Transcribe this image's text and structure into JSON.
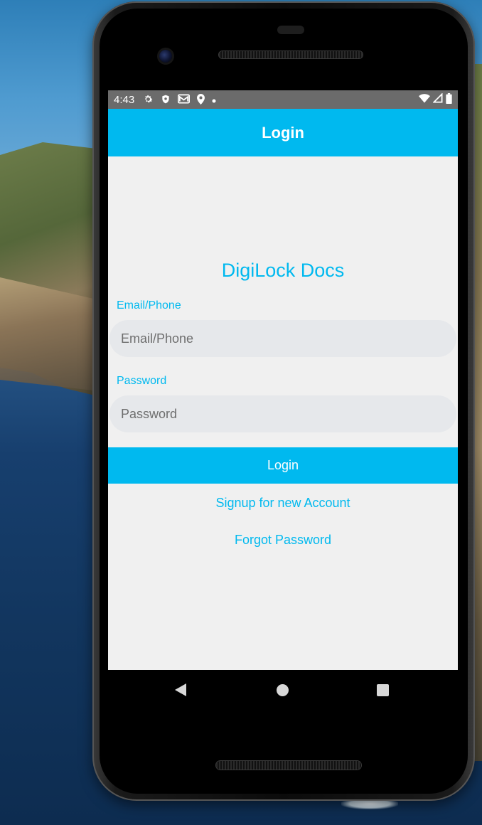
{
  "colors": {
    "accent": "#00b9ef",
    "status_bar": "#6b6b6b",
    "screen_bg": "#f0f0f0",
    "input_bg": "#e6e8eb"
  },
  "status_bar": {
    "time": "4:43",
    "icons_left": [
      "gear-icon",
      "shield-icon",
      "mail-icon",
      "location-icon",
      "dot-icon"
    ],
    "icons_right": [
      "wifi-icon",
      "signal-icon",
      "battery-icon"
    ]
  },
  "app_bar": {
    "title": "Login"
  },
  "brand": {
    "title": "DigiLock Docs"
  },
  "form": {
    "email_label": "Email/Phone",
    "email_placeholder": "Email/Phone",
    "email_value": "",
    "password_label": "Password",
    "password_placeholder": "Password",
    "password_value": "",
    "login_button": "Login"
  },
  "links": {
    "signup": "Signup for new Account",
    "forgot": "Forgot Password"
  },
  "nav": {
    "icons": [
      "back-icon",
      "home-icon",
      "recents-icon"
    ]
  }
}
